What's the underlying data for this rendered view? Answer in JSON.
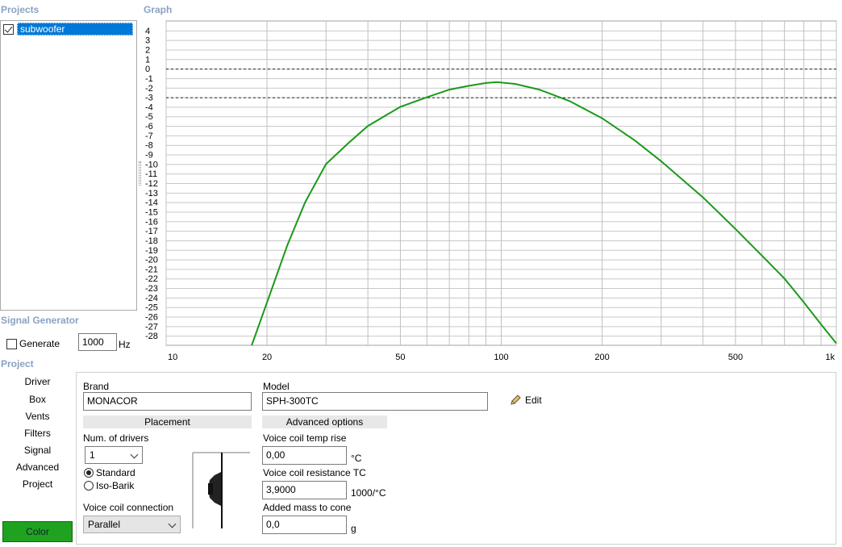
{
  "projects": {
    "title": "Projects",
    "items": [
      {
        "label": "subwoofer",
        "checked": true
      }
    ]
  },
  "signal_generator": {
    "title": "Signal Generator",
    "generate_label": "Generate",
    "generate_checked": false,
    "frequency": "1000",
    "unit": "Hz"
  },
  "graph": {
    "title": "Graph",
    "dashed_levels": [
      0,
      -3
    ]
  },
  "chart_data": {
    "type": "line",
    "x_scale": "log",
    "xlim": [
      10,
      1000
    ],
    "ylim": [
      -29,
      5
    ],
    "x_ticks": [
      10,
      20,
      30,
      40,
      50,
      60,
      70,
      80,
      90,
      100,
      200,
      300,
      400,
      500,
      600,
      700,
      800,
      900,
      1000
    ],
    "x_tick_labels": [
      {
        "value": 10,
        "label": "10"
      },
      {
        "value": 20,
        "label": "20"
      },
      {
        "value": 50,
        "label": "50"
      },
      {
        "value": 100,
        "label": "100"
      },
      {
        "value": 200,
        "label": "200"
      },
      {
        "value": 500,
        "label": "500"
      },
      {
        "value": 1000,
        "label": "1k"
      }
    ],
    "y_ticks": [
      4,
      3,
      2,
      1,
      0,
      -1,
      -2,
      -3,
      -4,
      -5,
      -6,
      -7,
      -8,
      -9,
      -10,
      -11,
      -12,
      -13,
      -14,
      -15,
      -16,
      -17,
      -18,
      -19,
      -20,
      -21,
      -22,
      -23,
      -24,
      -25,
      -26,
      -27,
      -28
    ],
    "grid": true,
    "line_color": "#1a9a1a",
    "series": [
      {
        "x": [
          18,
          20,
          23,
          26,
          30,
          35,
          40,
          50,
          60,
          70,
          80,
          90,
          97,
          110,
          130,
          160,
          200,
          250,
          300,
          400,
          500,
          600,
          700,
          800,
          900,
          1000
        ],
        "y": [
          -29,
          -24.5,
          -18.5,
          -14,
          -10,
          -7.8,
          -6,
          -4,
          -3,
          -2.2,
          -1.8,
          -1.5,
          -1.4,
          -1.6,
          -2.2,
          -3.4,
          -5.2,
          -7.5,
          -9.7,
          -13.5,
          -16.8,
          -19.6,
          -22,
          -24.5,
          -26.8,
          -28.8
        ]
      }
    ]
  },
  "project": {
    "title": "Project",
    "nav": [
      "Driver",
      "Box",
      "Vents",
      "Filters",
      "Signal",
      "Advanced",
      "Project"
    ],
    "active_nav": "Driver",
    "color_button": "Color",
    "color_value": "#1fa21f"
  },
  "driver": {
    "brand_label": "Brand",
    "brand_value": "MONACOR",
    "model_label": "Model",
    "model_value": "SPH-300TC",
    "edit_label": "Edit",
    "placement_header": "Placement",
    "num_drivers_label": "Num. of drivers",
    "num_drivers_value": "1",
    "standard_label": "Standard",
    "iso_barik_label": "Iso-Barik",
    "placement_selected": "Standard",
    "coil_connection_label": "Voice coil connection",
    "coil_connection_value": "Parallel",
    "advanced_header": "Advanced options",
    "temp_rise_label": "Voice coil temp rise",
    "temp_rise_value": "0,00",
    "temp_rise_unit": "°C",
    "resistance_tc_label": "Voice coil resistance TC",
    "resistance_tc_value": "3,9000",
    "resistance_tc_unit": "1000/°C",
    "added_mass_label": "Added mass to cone",
    "added_mass_value": "0,0",
    "added_mass_unit": "g"
  }
}
